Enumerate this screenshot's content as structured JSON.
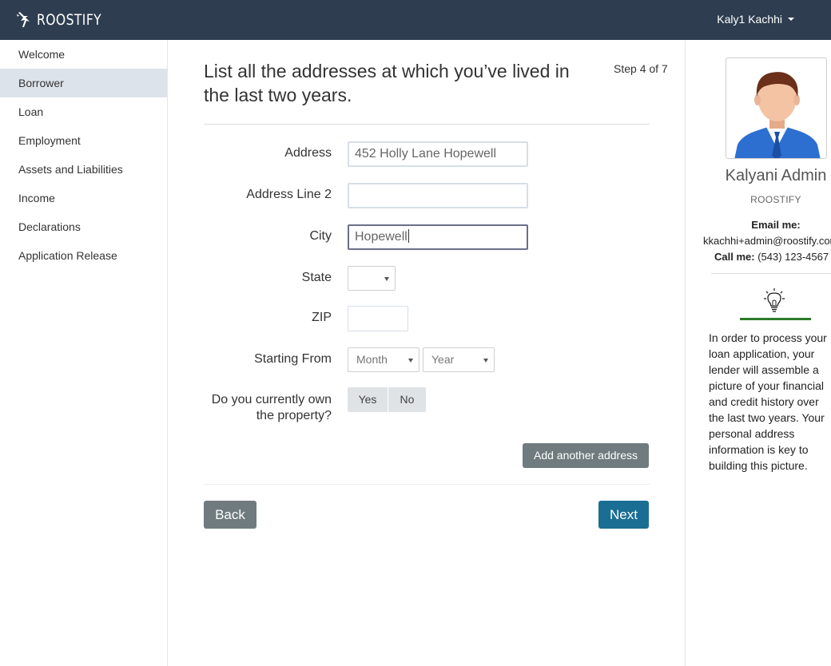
{
  "topbar": {
    "brand": "ROOSTIFY",
    "user_name": "Kaly1 Kachhi",
    "user_icon": "chevron-down-icon",
    "background_color": "#2e3e50"
  },
  "sidebar": {
    "items": [
      {
        "label": "Welcome",
        "active": false
      },
      {
        "label": "Borrower",
        "active": true
      },
      {
        "label": "Loan",
        "active": false
      },
      {
        "label": "Employment",
        "active": false
      },
      {
        "label": "Assets and Liabilities",
        "active": false
      },
      {
        "label": "Income",
        "active": false
      },
      {
        "label": "Declarations",
        "active": false
      },
      {
        "label": "Application Release",
        "active": false
      }
    ]
  },
  "main": {
    "heading": "List all the addresses at which you’ve lived in the last two years.",
    "step": "Step 4 of 7",
    "fields": {
      "address": {
        "label": "Address",
        "value": "452 Holly Lane  Hopewell",
        "placeholder": ""
      },
      "address2": {
        "label": "Address Line 2",
        "value": "",
        "placeholder": ""
      },
      "city": {
        "label": "City",
        "value": "Hopewell",
        "placeholder": ""
      },
      "state": {
        "label": "State",
        "value": ""
      },
      "zip": {
        "label": "ZIP",
        "value": ""
      },
      "starting_from": {
        "label": "Starting From",
        "month": "Month",
        "year": "Year"
      },
      "own_property": {
        "label_line1": "Do you currently own",
        "label_line2": "the property?",
        "yes": "Yes",
        "no": "No"
      }
    },
    "buttons": {
      "add_address": "Add another address",
      "back": "Back",
      "next": "Next"
    },
    "colors": {
      "next_button": "#1a6e93",
      "secondary_button": "#6f7b7f"
    }
  },
  "agent": {
    "name": "Kalyani Admin",
    "company": "ROOSTIFY",
    "email_label": "Email me:",
    "email": "kkachhi+admin@roostify.com",
    "call_label": "Call me:",
    "phone": "(543) 123-4567",
    "tip_icon": "lightbulb-icon",
    "tip": "In order to process your loan application, your lender will assemble a picture of your financial and credit history over the last two years. Your personal address information is key to building this picture.",
    "accent_color": "#2c7a2c"
  }
}
